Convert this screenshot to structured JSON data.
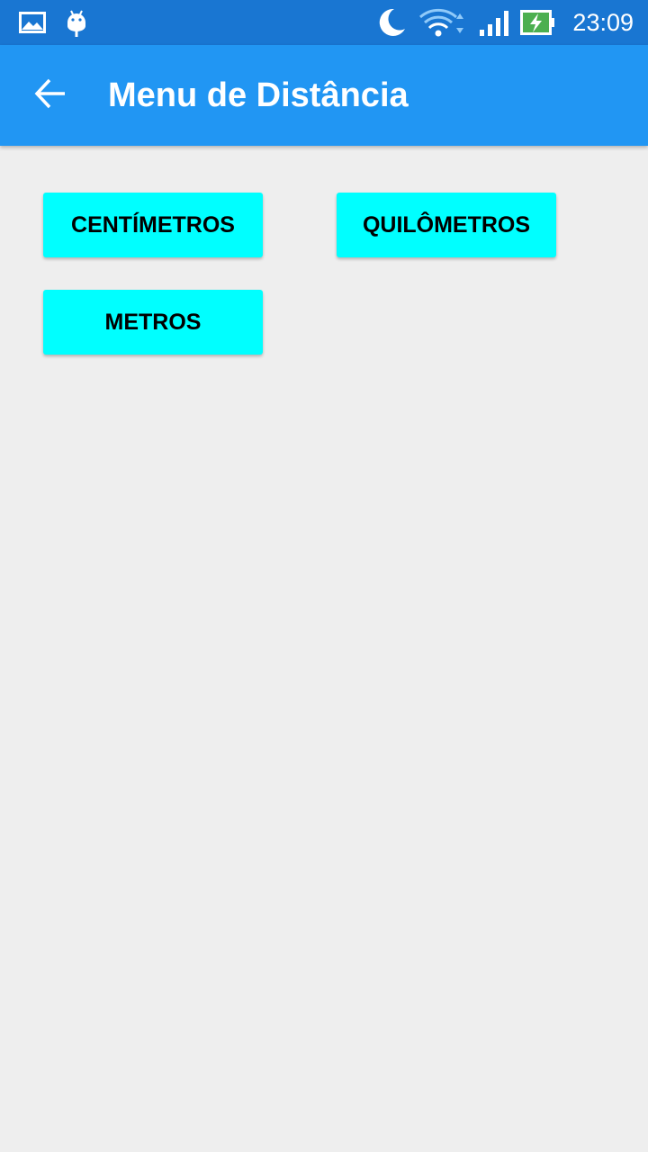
{
  "status_bar": {
    "time": "23:09",
    "icons": [
      "image-icon",
      "android-icon",
      "moon-icon",
      "wifi-icon",
      "signal-icon",
      "battery-charging-icon"
    ],
    "background": "#1976d2"
  },
  "app_bar": {
    "title": "Menu de Distância",
    "back_icon": "arrow-back-icon",
    "background": "#2196f3"
  },
  "buttons": {
    "centimetros": "CENTÍMETROS",
    "quilometros": "QUILÔMETROS",
    "metros": "METROS",
    "color": "#00ffff"
  },
  "page": {
    "background": "#eeeeee"
  }
}
